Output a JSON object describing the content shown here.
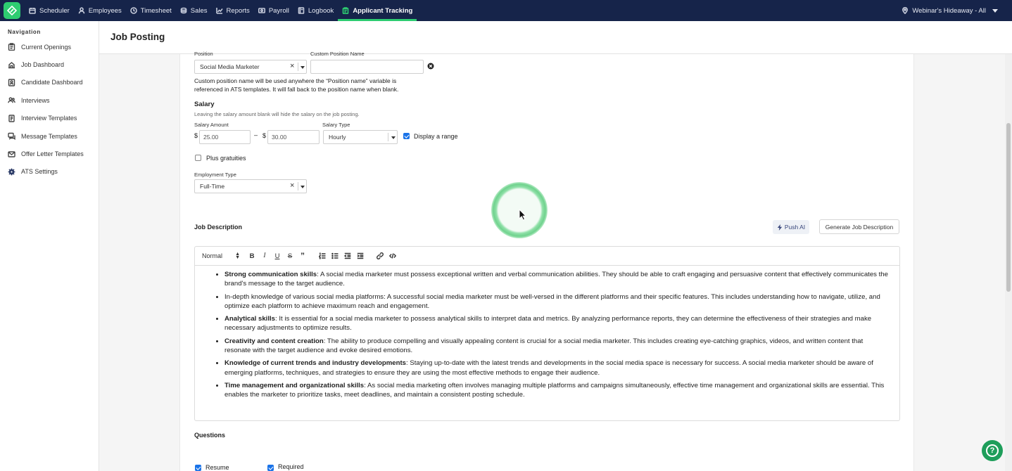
{
  "topnav": {
    "items": [
      {
        "label": "Scheduler",
        "icon": "calendar-icon"
      },
      {
        "label": "Employees",
        "icon": "user-icon"
      },
      {
        "label": "Timesheet",
        "icon": "clock-icon"
      },
      {
        "label": "Sales",
        "icon": "coins-icon"
      },
      {
        "label": "Reports",
        "icon": "chart-icon"
      },
      {
        "label": "Payroll",
        "icon": "payroll-icon"
      },
      {
        "label": "Logbook",
        "icon": "book-icon"
      },
      {
        "label": "Applicant Tracking",
        "icon": "clipboard-icon",
        "active": true
      }
    ],
    "location": "Webinar's Hideaway - All"
  },
  "sidebar": {
    "heading": "Navigation",
    "items": [
      {
        "label": "Current Openings",
        "icon": "clipboard-icon"
      },
      {
        "label": "Job Dashboard",
        "icon": "dashboard-icon"
      },
      {
        "label": "Candidate Dashboard",
        "icon": "candidate-icon"
      },
      {
        "label": "Interviews",
        "icon": "users-icon"
      },
      {
        "label": "Interview Templates",
        "icon": "template-icon"
      },
      {
        "label": "Message Templates",
        "icon": "message-icon"
      },
      {
        "label": "Offer Letter Templates",
        "icon": "letter-icon"
      },
      {
        "label": "ATS Settings",
        "icon": "gear-icon"
      }
    ]
  },
  "page": {
    "title": "Job Posting"
  },
  "form": {
    "position_label": "Position",
    "position_value": "Social Media Marketer",
    "custom_position_label": "Custom Position Name",
    "custom_position_value": "",
    "custom_position_help_line1": "Custom position name will be used anywhere the “Position name” variable is",
    "custom_position_help_line2": "referenced in ATS templates. It will fall back to the position name when blank.",
    "salary_title": "Salary",
    "salary_hint": "Leaving the salary amount blank will hide the salary on the job posting.",
    "salary_amount_label": "Salary Amount",
    "currency_symbol": "$",
    "salary_min": "25.00",
    "range_dash": "–",
    "salary_max": "30.00",
    "salary_type_label": "Salary Type",
    "salary_type_value": "Hourly",
    "display_range_label": "Display a range",
    "display_range_checked": true,
    "plus_gratuities_label": "Plus gratuities",
    "plus_gratuities_checked": false,
    "employment_type_label": "Employment Type",
    "employment_type_value": "Full-Time",
    "job_description_title": "Job Description",
    "push_ai_label": "Push AI",
    "generate_label": "Generate Job Description",
    "questions_title": "Questions",
    "resume_label": "Resume",
    "resume_checked": true,
    "required_label": "Required",
    "required_checked": true
  },
  "editor": {
    "format_value": "Normal",
    "bullets": [
      {
        "bold": "Strong communication skills",
        "text": ": A social media marketer must possess exceptional written and verbal communication abilities. They should be able to craft engaging and persuasive content that effectively communicates the brand's message to the target audience."
      },
      {
        "bold": "",
        "text": "In-depth knowledge of various social media platforms: A successful social media marketer must be well-versed in the different platforms and their specific features. This includes understanding how to navigate, utilize, and optimize each platform to achieve maximum reach and engagement."
      },
      {
        "bold": "Analytical skills",
        "text": ": It is essential for a social media marketer to possess analytical skills to interpret data and metrics. By analyzing performance reports, they can determine the effectiveness of their strategies and make necessary adjustments to optimize results."
      },
      {
        "bold": "Creativity and content creation",
        "text": ": The ability to produce compelling and visually appealing content is crucial for a social media marketer. This includes creating eye-catching graphics, videos, and written content that resonate with the target audience and evoke desired emotions."
      },
      {
        "bold": "Knowledge of current trends and industry developments",
        "text": ": Staying up-to-date with the latest trends and developments in the social media space is necessary for success. A social media marketer should be aware of emerging platforms, techniques, and strategies to ensure they are using the most effective methods to engage their audience."
      },
      {
        "bold": "Time management and organizational skills",
        "text": ": As social media marketing often involves managing multiple platforms and campaigns simultaneously, effective time management and organizational skills are essential. This enables the marketer to prioritize tasks, meet deadlines, and maintain a consistent posting schedule."
      }
    ]
  },
  "colors": {
    "topbar": "#16244a",
    "accent": "#2ecc71",
    "checkbox": "#1a73e8",
    "help": "#1e9e5a"
  }
}
